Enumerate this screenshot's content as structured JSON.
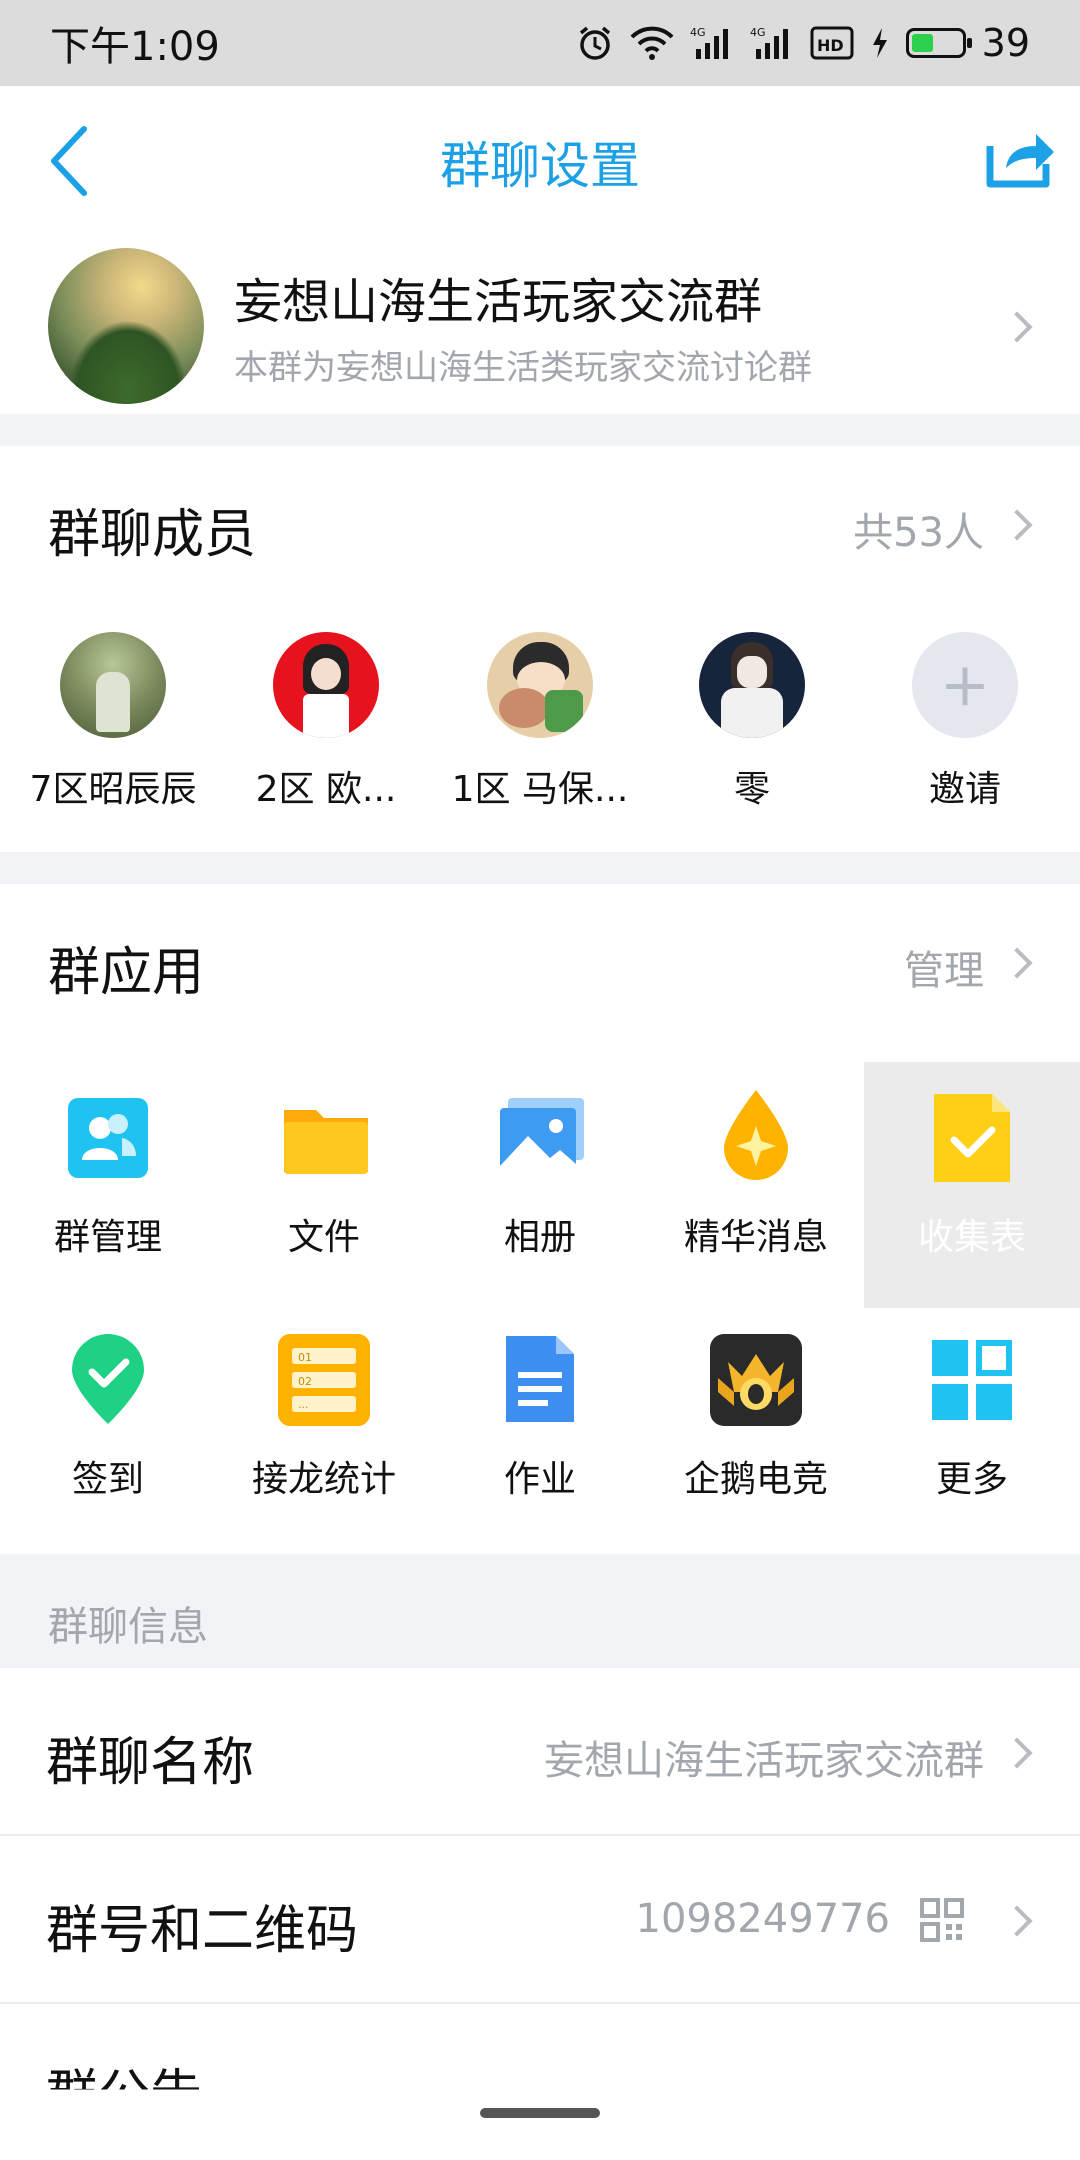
{
  "status_bar": {
    "time": "下午1:09",
    "battery": "39",
    "network1": "4G",
    "network2": "4G",
    "hd": "HD"
  },
  "header": {
    "title": "群聊设置"
  },
  "group": {
    "name": "妄想山海生活玩家交流群",
    "description": "本群为妄想山海生活类玩家交流讨论群"
  },
  "members": {
    "title": "群聊成员",
    "count": "共53人",
    "items": [
      {
        "label": "7区昭辰辰"
      },
      {
        "label": "2区  欧..."
      },
      {
        "label": "1区 马保..."
      },
      {
        "label": "零"
      },
      {
        "label": "邀请"
      }
    ]
  },
  "apps": {
    "title": "群应用",
    "manage": "管理",
    "items": [
      {
        "label": "群管理",
        "icon": "group-manage-icon",
        "color": "#1ec3f2"
      },
      {
        "label": "文件",
        "icon": "folder-icon",
        "color": "#ffc11a"
      },
      {
        "label": "相册",
        "icon": "album-icon",
        "color": "#3d9cf2"
      },
      {
        "label": "精华消息",
        "icon": "essence-icon",
        "color": "#ffb300"
      },
      {
        "label": "收集表",
        "icon": "collect-form-icon",
        "color": "#ffcf16"
      },
      {
        "label": "签到",
        "icon": "checkin-icon",
        "color": "#1ed184"
      },
      {
        "label": "接龙统计",
        "icon": "solitaire-icon",
        "color": "#ffb300"
      },
      {
        "label": "作业",
        "icon": "homework-icon",
        "color": "#3d8ff2"
      },
      {
        "label": "企鹅电竞",
        "icon": "penguin-esports-icon",
        "color": "#2a2a2a"
      },
      {
        "label": "更多",
        "icon": "more-apps-icon",
        "color": "#1ec3f2"
      }
    ]
  },
  "info": {
    "section_title": "群聊信息",
    "name_label": "群聊名称",
    "name_value": "妄想山海生活玩家交流群",
    "id_label": "群号和二维码",
    "id_value": "1098249776",
    "announcement_label": "群公告"
  }
}
